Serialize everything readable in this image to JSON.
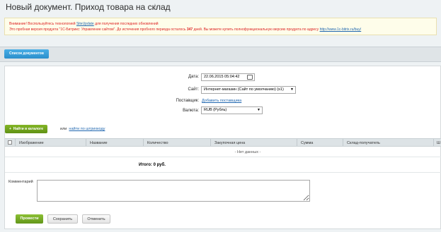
{
  "page": {
    "title": "Новый документ. Приход товара на склад"
  },
  "warning": {
    "line1_prefix": "Внимание! Воспользуйтесь технологией",
    "line1_link": "SiteUpdate",
    "line1_suffix": "для получения последних обновлений",
    "line2_prefix": "Это пробная версия продукта \"1С-Битрикс: Управление сайтом\". До истечения пробного периода осталось",
    "line2_days": "347",
    "line2_suffix": "дней. Вы можете купить полнофункциональную версию продукта по адресу",
    "line2_link": "http://www.1c-bitrix.ru/buy/"
  },
  "toolbar": {
    "doc_list_label": "Список документов"
  },
  "form": {
    "date_label": "Дата:",
    "date_value": "22.06.2015 05:04:42",
    "site_label": "Сайт:",
    "site_value": "Интернет-магазин (Сайт по умолчанию) (s1)",
    "supplier_label": "Поставщик:",
    "supplier_link": "Добавить поставщика",
    "currency_label": "Валюта:",
    "currency_value": "RUB (Рубль)"
  },
  "catalog": {
    "find_button": "Найти в каталоге",
    "or_text": "или",
    "barcode_link": "найти по штрихкоду"
  },
  "table": {
    "columns": [
      "Изображение",
      "Название",
      "Количество",
      "Закупочная цена",
      "Сумма",
      "Склад-получатель",
      "Ш"
    ],
    "empty_text": "- Нет данных -",
    "total_text": "Итого: 0 руб."
  },
  "comment": {
    "label": "Комментарий"
  },
  "footer": {
    "submit_label": "Провести",
    "save_label": "Сохранить",
    "cancel_label": "Отменить"
  },
  "colors": {
    "accent_blue": "#2b8fcc",
    "accent_green": "#62961a",
    "warning_red": "#d22222",
    "link": "#2067b0"
  }
}
